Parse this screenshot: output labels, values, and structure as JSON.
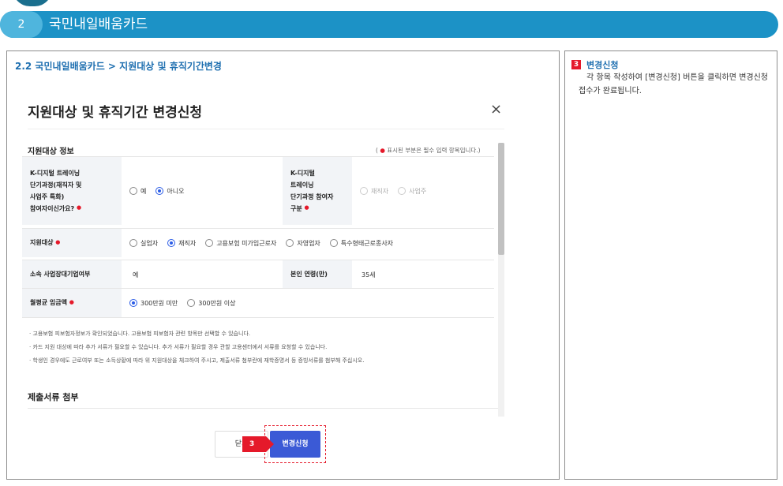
{
  "header": {
    "step_number": "2",
    "title": "국민내일배움카드"
  },
  "breadcrumb": "2.2 국민내일배움카드 > 지원대상 및 휴직기간변경",
  "modal": {
    "title": "지원대상 및 휴직기간 변경신청",
    "close_symbol": "×",
    "section_title": "지원대상 정보",
    "required_note_prefix": "( ",
    "required_note_dot": "●",
    "required_note_text": " 표시된 부분은 필수 입력 항목입니다.)",
    "required_mark": "●",
    "rows": {
      "k_digital_label": [
        "K-디지털 트레이닝",
        "단기과정(재직자 및",
        "사업주 특화)",
        "참여자이신가요?"
      ],
      "k_digital_options": [
        "예",
        "아니오"
      ],
      "k_digital_selected": "아니오",
      "k_type_label": [
        "K-디지털",
        "트레이닝",
        "단기과정 참여자",
        "구분"
      ],
      "k_type_options": [
        "재직자",
        "사업주"
      ],
      "target_label": "지원대상",
      "target_options": [
        "실업자",
        "재직자",
        "고용보험 미가입근로자",
        "자영업자",
        "특수형태근로종사자"
      ],
      "target_selected": "재직자",
      "company_label": "소속 사업장대기업여부",
      "company_value": "예",
      "age_label": "본인 연령(만)",
      "age_value": "35세",
      "wage_label": "월평균 임금액",
      "wage_options": [
        "300만원 미만",
        "300만원 이상"
      ],
      "wage_selected": "300만원 미만"
    },
    "notes": [
      "고용보험 피보험자정보가 확인되었습니다. 고용보험 피보험자 관련 항목만 선택할 수 있습니다.",
      "카드 지원 대상에 따라 추가 서류가 필요할 수 있습니다. 추가 서류가 필요할 경우 관할 고용센터에서 서류를 요청할 수 있습니다.",
      "학생인 경우에도 근로여부 또는 소득상황에 따라 위 지원대상을 체크하여 주시고, 제출서류 첨부란에 재학증명서 등 증빙서류를 첨부해 주십시오."
    ],
    "attach_title": "제출서류 첨부",
    "close_button": "닫기",
    "apply_button": "변경신청",
    "marker_number": "3"
  },
  "side": {
    "badge": "3",
    "title": "변경신청",
    "description": "각 항목 작성하여 [변경신청] 버튼을 클릭하면 변경신청 접수가 완료됩니다."
  }
}
